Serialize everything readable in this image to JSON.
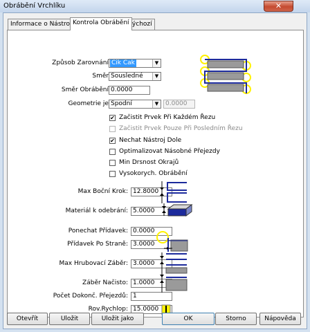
{
  "window": {
    "title": "Obrábění Vrchlíku",
    "close_glyph": "✕"
  },
  "tabs": [
    {
      "label": "Informace o Nástroji"
    },
    {
      "label": "Kontrola Obrábění"
    },
    {
      "label": "Výchozí"
    }
  ],
  "form": {
    "zpusob_zarovnani": {
      "label": "Způsob Zarovnání:",
      "value": "Cik Cak"
    },
    "smer": {
      "label": "Směr:",
      "value": "Sousledné"
    },
    "smer_obrabeni": {
      "label": "Směr Obrábění:",
      "value": "0.0000"
    },
    "geometrie": {
      "label": "Geometrie je:",
      "value": "Spodní",
      "extra_value": "0.0000"
    },
    "options": [
      {
        "label": "Začistit Prvek Při Každém Řezu",
        "checked": true,
        "enabled": true
      },
      {
        "label": "Začistit Prvek Pouze Při Posledním Řezu",
        "checked": false,
        "enabled": false
      },
      {
        "label": "Nechat Nástroj Dole",
        "checked": true,
        "enabled": true
      },
      {
        "label": "Optimalizovat Násobné Přejezdy",
        "checked": false,
        "enabled": true
      },
      {
        "label": "Min Drsnost Okrajů",
        "checked": false,
        "enabled": true
      },
      {
        "label": "Vysokorych. Obrábění",
        "checked": false,
        "enabled": true
      }
    ],
    "max_bocni_krok": {
      "label": "Max Boční Krok:",
      "value": "12.8000"
    },
    "material_k_odebrani": {
      "label": "Materiál k odebrání:",
      "value": "5.0000"
    },
    "ponechat_pridavek": {
      "label": "Ponechat Přídavek:",
      "value": "0.0000"
    },
    "pridavek_po_strane": {
      "label": "Přídavek Po Straně:",
      "value": "3.0000"
    },
    "max_hrubovaci_zaber": {
      "label": "Max Hrubovací Záběr:",
      "value": "3.0000"
    },
    "zaber_nacisto": {
      "label": "Záběr Načisto:",
      "value": "1.0000"
    },
    "pocet_dokonc_prejezdu": {
      "label": "Počet Dokonč. Přejezdů:",
      "value": "1"
    },
    "rov_rychlop": {
      "label": "Rov.Rychlop:",
      "value": "15.0000"
    }
  },
  "buttons": {
    "open": "Otevřít",
    "save": "Uložit",
    "save_as": "Uložit jako",
    "ok": "OK",
    "cancel": "Storno",
    "help": "Nápověda"
  },
  "icons": {
    "check_glyph": "✔",
    "dropdown_glyph": "▼",
    "zigzag_toolpath": "zigzag-toolpath-icon",
    "stepover": "stepover-icon",
    "stock_block": "stock-block-icon",
    "side_allowance": "side-allowance-icon",
    "rough_depth": "rough-depth-icon",
    "finish_depth": "finish-depth-icon",
    "rapid_plane": "rapid-plane-icon"
  },
  "colors": {
    "toolpath": "#1c2a9c",
    "highlight": "#fff200",
    "selection": "#3399ff"
  }
}
